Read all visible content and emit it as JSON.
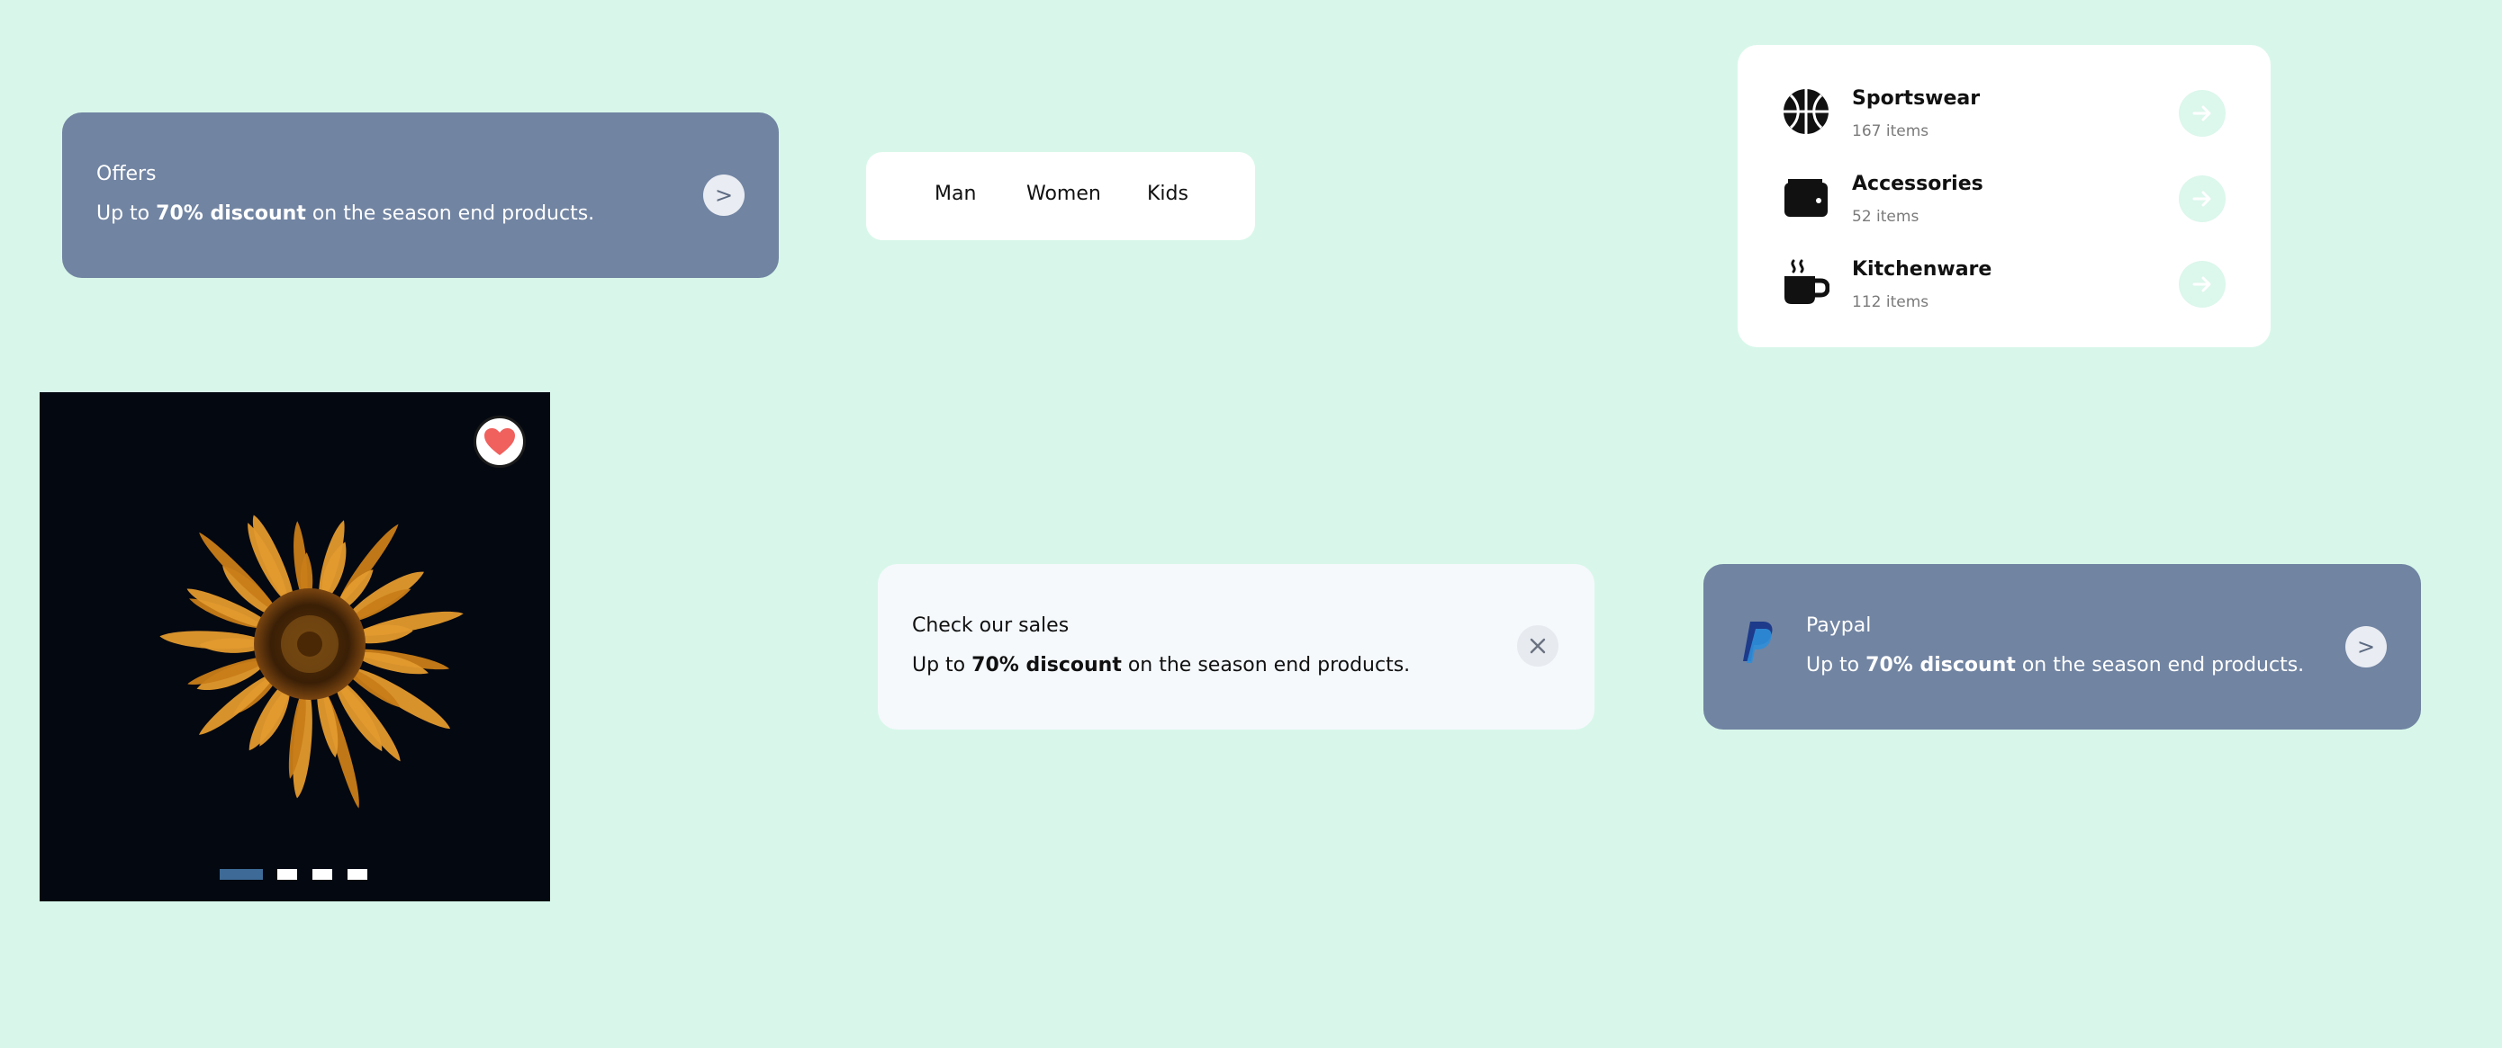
{
  "offers_card": {
    "title": "Offers",
    "text_prefix": "Up to ",
    "text_bold": "70% discount",
    "text_suffix": " on the season end products.",
    "button_label": ">"
  },
  "tabs": [
    {
      "label": "Man"
    },
    {
      "label": "Women"
    },
    {
      "label": "Kids"
    }
  ],
  "categories": [
    {
      "name": "Sportswear",
      "count": "167 items",
      "icon": "basketball-icon"
    },
    {
      "name": "Accessories",
      "count": "52 items",
      "icon": "wallet-icon"
    },
    {
      "name": "Kitchenware",
      "count": "112 items",
      "icon": "coffee-cup-icon"
    }
  ],
  "image_card": {
    "icon": "heart-icon",
    "slides_total": 4,
    "active_slide": 1
  },
  "sales_card": {
    "title": "Check our sales",
    "text_prefix": "Up to ",
    "text_bold": "70% discount",
    "text_suffix": " on the season end products.",
    "close_icon": "close-icon"
  },
  "paypal_card": {
    "title": "Paypal",
    "text_prefix": "Up to ",
    "text_bold": "70% discount",
    "text_suffix": " on the season end products.",
    "button_label": ">",
    "icon": "paypal-logo-icon"
  },
  "colors": {
    "background": "#d8f7ea",
    "card_slate": "#7184a2",
    "accent_mint": "#dcf7ec",
    "heart_red": "#f0605d",
    "active_dot": "#3d6a96"
  }
}
